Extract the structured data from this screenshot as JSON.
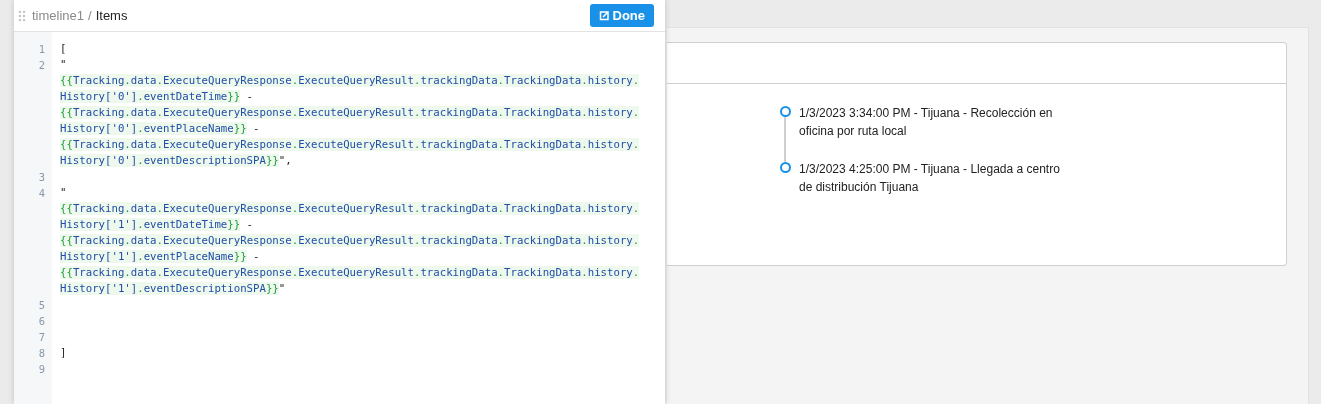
{
  "editor": {
    "breadcrumb": {
      "parent": "timeline1",
      "separator": "/",
      "current": "Items"
    },
    "done_button": "Done",
    "lines": [
      {
        "number": "1",
        "rows": [
          "["
        ]
      },
      {
        "number": "2",
        "rows": [
          "\"",
          "{{Tracking.data.ExecuteQueryResponse.ExecuteQueryResult.trackingData.TrackingData.history.",
          "History['0'].eventDateTime}} -",
          "{{Tracking.data.ExecuteQueryResponse.ExecuteQueryResult.trackingData.TrackingData.history.",
          "History['0'].eventPlaceName}} -",
          "{{Tracking.data.ExecuteQueryResponse.ExecuteQueryResult.trackingData.TrackingData.history.",
          "History['0'].eventDescriptionSPA}}\","
        ]
      },
      {
        "number": "3",
        "rows": [
          ""
        ]
      },
      {
        "number": "4",
        "rows": [
          "\"",
          "{{Tracking.data.ExecuteQueryResponse.ExecuteQueryResult.trackingData.TrackingData.history.",
          "History['1'].eventDateTime}} -",
          "{{Tracking.data.ExecuteQueryResponse.ExecuteQueryResult.trackingData.TrackingData.history.",
          "History['1'].eventPlaceName}} -",
          "{{Tracking.data.ExecuteQueryResponse.ExecuteQueryResult.trackingData.TrackingData.history.",
          "History['1'].eventDescriptionSPA}}\""
        ]
      },
      {
        "number": "5",
        "rows": [
          ""
        ]
      },
      {
        "number": "6",
        "rows": [
          ""
        ]
      },
      {
        "number": "7",
        "rows": [
          ""
        ]
      },
      {
        "number": "8",
        "rows": [
          "]"
        ]
      },
      {
        "number": "9",
        "rows": [
          ""
        ]
      }
    ]
  },
  "timeline": {
    "events": [
      {
        "text": "1/3/2023 3:34:00 PM - Tijuana - Recolección en oficina por ruta local"
      },
      {
        "text": "1/3/2023 4:25:00 PM - Tijuana - Llegada a centro de distribución Tijuana"
      }
    ]
  }
}
